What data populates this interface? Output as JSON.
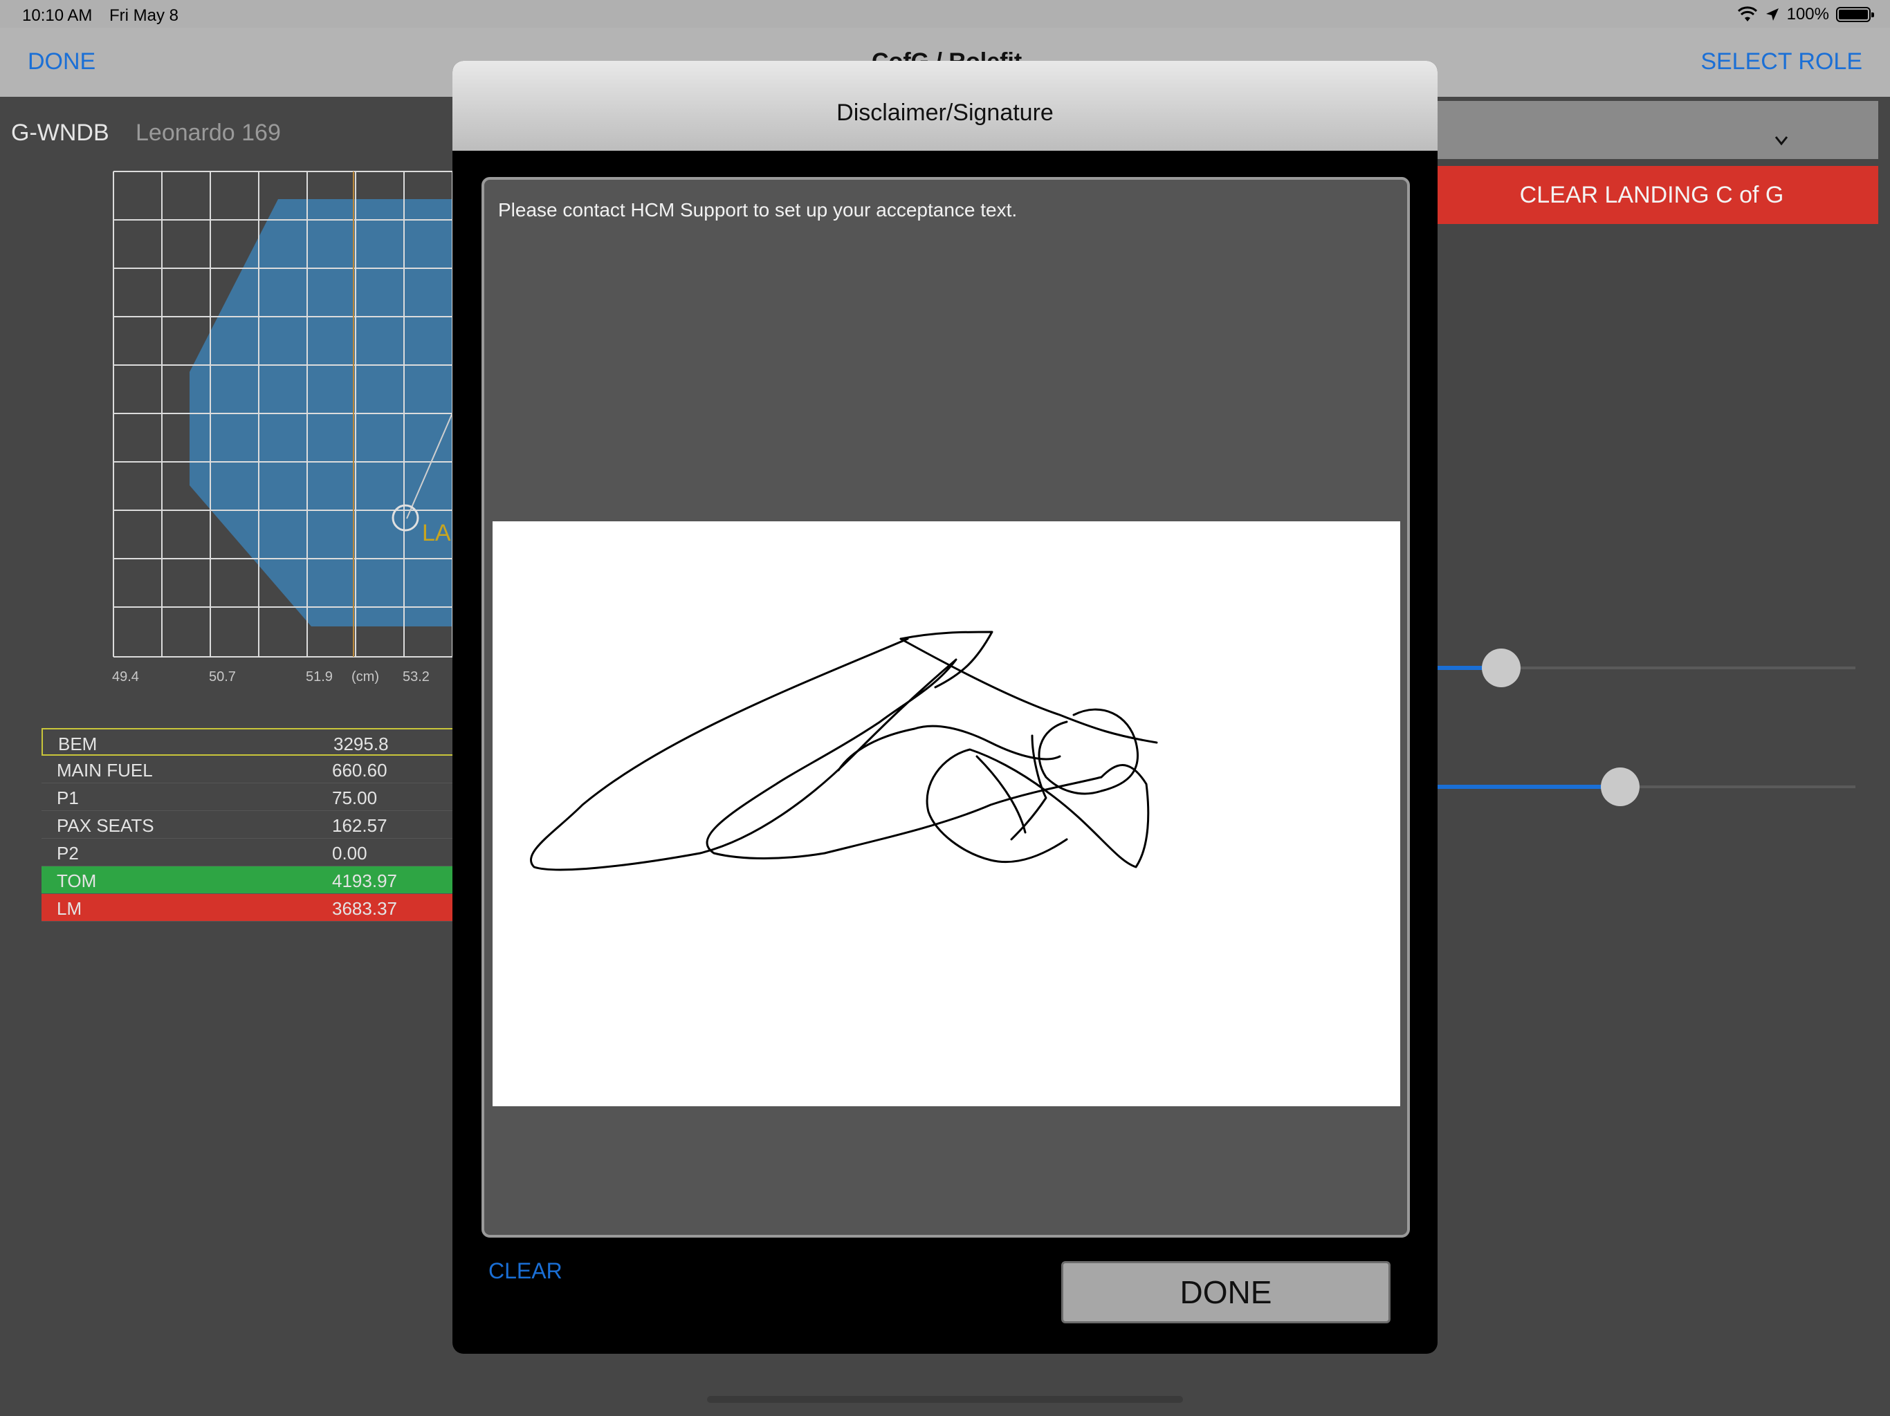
{
  "status_bar": {
    "time": "10:10 AM",
    "date": "Fri May 8",
    "battery": "100%",
    "icons": [
      "wifi-icon",
      "location-arrow-icon",
      "battery-icon"
    ]
  },
  "nav": {
    "done_label": "DONE",
    "title": "CofG / Rolefit",
    "select_role_label": "SELECT ROLE"
  },
  "aircraft": {
    "registration": "G-WNDB",
    "model": "Leonardo 169"
  },
  "envelope_chart": {
    "x_tick_labels": [
      "49.4",
      "50.7",
      "51.9",
      "(cm)",
      "53.2"
    ],
    "partial_label": "LA",
    "colors": {
      "envelope": "#3d7fb0",
      "grid": "#dcdcdc",
      "label": "#c9a51e"
    }
  },
  "weights": [
    {
      "label": "BEM",
      "value": "3295.8",
      "style": "bem"
    },
    {
      "label": "MAIN FUEL",
      "value": "660.60",
      "style": "normal"
    },
    {
      "label": "P1",
      "value": "75.00",
      "style": "normal"
    },
    {
      "label": "PAX SEATS",
      "value": "162.57",
      "style": "normal"
    },
    {
      "label": "P2",
      "value": "0.00",
      "style": "normal"
    },
    {
      "label": "TOM",
      "value": "4193.97",
      "style": "tom"
    },
    {
      "label": "LM",
      "value": "3683.37",
      "style": "lm"
    }
  ],
  "right_panel": {
    "clear_landing_label": "CLEAR LANDING C of G",
    "chevron_icon": "chevron-down-icon",
    "sliders": [
      {
        "name": "slider-1",
        "fraction": 0.1
      },
      {
        "name": "slider-2",
        "fraction": 0.35
      }
    ]
  },
  "modal": {
    "title": "Disclaimer/Signature",
    "disclaimer_text": "Please contact HCM Support to set up your acceptance text.",
    "clear_label": "CLEAR",
    "done_label": "DONE"
  },
  "colors": {
    "accent_blue": "#1a6fd6",
    "tom_green": "#2ea544",
    "lm_red": "#d5332a"
  }
}
